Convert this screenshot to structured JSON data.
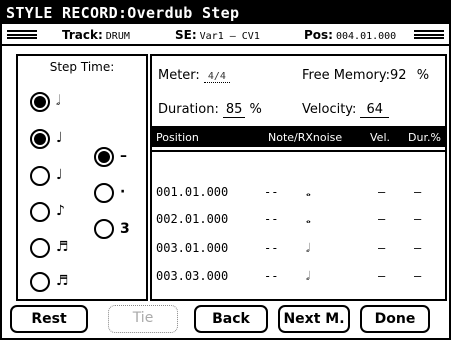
{
  "title": "STYLE RECORD:Overdub Step",
  "infobar": {
    "track_label": "Track:",
    "track_value": "DRUM",
    "se_label": "SE:",
    "se_value": "Var1 – CV1",
    "pos_label": "Pos:",
    "pos_value": "004.01.000"
  },
  "step_time": {
    "heading": "Step Time:",
    "options": [
      {
        "glyph": "𝅗𝅥",
        "icon": "half-note-icon",
        "selected": true
      },
      {
        "glyph": "♩",
        "icon": "quarter-note-icon",
        "selected": true
      },
      {
        "glyph": "♩",
        "icon": "quarter-note-icon",
        "selected": false
      },
      {
        "glyph": "♪",
        "icon": "eighth-note-icon",
        "selected": false
      },
      {
        "glyph": "♬",
        "icon": "sixteenth-note-icon",
        "selected": false
      },
      {
        "glyph": "♬",
        "icon": "thirty-second-note-icon",
        "selected": false
      }
    ],
    "modifiers": [
      {
        "label": "–",
        "selected": true
      },
      {
        "label": "·",
        "selected": false
      },
      {
        "label": "3",
        "selected": false
      }
    ]
  },
  "params": {
    "meter_label": "Meter:",
    "meter_value": "4/4",
    "free_memory_label": "Free Memory:",
    "free_memory_value": "92",
    "free_memory_unit": "%",
    "duration_label": "Duration:",
    "duration_value": "85",
    "duration_unit": "%",
    "velocity_label": "Velocity:",
    "velocity_value": "64"
  },
  "event_list": {
    "columns": [
      "Position",
      "Note/RXnoise",
      "Vel.",
      "Dur.%"
    ],
    "rows": [
      {
        "position": "001.01.000",
        "note": "--",
        "glyph": "𝅝",
        "vel": "–",
        "dur": "–"
      },
      {
        "position": "002.01.000",
        "note": "--",
        "glyph": "𝅝",
        "vel": "–",
        "dur": "–"
      },
      {
        "position": "003.01.000",
        "note": "--",
        "glyph": "𝅗𝅥",
        "vel": "–",
        "dur": "–"
      },
      {
        "position": "003.03.000",
        "note": "--",
        "glyph": "𝅗𝅥",
        "vel": "–",
        "dur": "–"
      }
    ]
  },
  "buttons": {
    "rest": "Rest",
    "tie": "Tie",
    "back": "Back",
    "next": "Next M.",
    "done": "Done"
  }
}
